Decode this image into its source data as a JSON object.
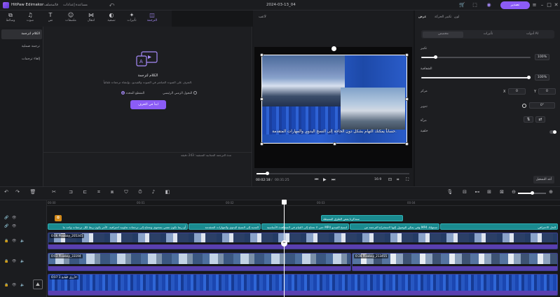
{
  "app": {
    "name": "HitPaw Edimakor",
    "project": "2024-03-13_04",
    "export_label": "تصدير"
  },
  "menu": [
    "ملف",
    "إعدادات",
    "قائمة",
    "مساعدة"
  ],
  "toolbar": {
    "tools": [
      {
        "label": "وسائط",
        "icon": "media-icon"
      },
      {
        "label": "صوت",
        "icon": "audio-icon"
      },
      {
        "label": "نص",
        "icon": "text-icon"
      },
      {
        "label": "ملصقات",
        "icon": "sticker-icon"
      },
      {
        "label": "انتقال",
        "icon": "transition-icon"
      },
      {
        "label": "تصفية",
        "icon": "filter-icon"
      },
      {
        "label": "تأثيرات",
        "icon": "effects-icon"
      },
      {
        "label": "الترجمة",
        "icon": "subtitle-icon"
      }
    ],
    "active_index": 7
  },
  "left_nav": [
    "الكلام لترجمة",
    "ترجمة صملية",
    "إلغاء ترجمات"
  ],
  "feature": {
    "title": "الكلام لترجمة",
    "description": "التعرف على الصوت المباشر في الصوت والفيديو ، وإنشاء ترجمات تلقائياً.",
    "radio_auto": "التحول الزمني الرئيسي",
    "radio_selected": "المقطع المحدد",
    "try_button": "ابدأ في التعرف",
    "footer": "مدة الترجمة المجانية المتبقية: 243 دقيقة"
  },
  "preview": {
    "label": "لاعب",
    "subtitle": "حساباً يمكنك التهام بشكل دون الحاجة إلى النسخ اليدوي والمهارات المتقدمة.",
    "time_current": "00:02:18",
    "time_total": "00:31:25",
    "aspect": "16:9",
    "progress": 0.07
  },
  "right_panel": {
    "tabs": [
      "عرض",
      "تكبير الحركة",
      "لون"
    ],
    "active_tab": 0,
    "subtabs": [
      "مخصص",
      "تأثيرات",
      "أدوات AI"
    ],
    "active_subtab": 0,
    "scale_label": "تكبير",
    "scale_value": "100%",
    "scale_level": 0.13,
    "opacity_label": "الشفافية",
    "opacity_value": "100%",
    "opacity_level": 1.0,
    "position_label": "مركز",
    "pos_x_label": "X",
    "pos_x": "0",
    "pos_y_label": "Y",
    "pos_y": "0",
    "rotate_label": "تدوير",
    "rotate_value": "0°",
    "mirror_label": "مرآة",
    "blur_label": "خلفية",
    "reset_label": "أعد التشغيل"
  },
  "timeline": {
    "ruler": [
      "00:00",
      "00:01",
      "00:02",
      "00:03",
      "00:04"
    ],
    "text_clip_main": "ستذكرنا بعض الطرق البسيطة",
    "subtitle_clips": [
      "أو ربما تكون تعتني بمحتوى وتحتاج إلى ترجمات تعاونية احترافية. الأمر يكون ربط لكل ترجمات واحد ما",
      "المدية إلى النسخ اليدوي والمهارات المتقدمة",
      "حتى لا تحتاج إلى القيام في المشاهدة الأساسية MP4 لنسخ الفيديو",
      "وفي يمكن للوصول إليها لاستخراج الترجمة من MP4 تستهلك",
      "الحل الاحترافي"
    ],
    "video_clips": [
      {
        "name": "0:06 Pixabay_205345"
      },
      {
        "name": "0:03 Pixabay_33194"
      },
      {
        "name": "0:28 Pixabay_213455"
      },
      {
        "name": "الأزرق الفاتح 1 0:07"
      }
    ]
  },
  "colors": {
    "accent": "#8b5cf6",
    "subtitle_clip": "#1a8a8f",
    "video_bar": "#5a3fb0"
  }
}
